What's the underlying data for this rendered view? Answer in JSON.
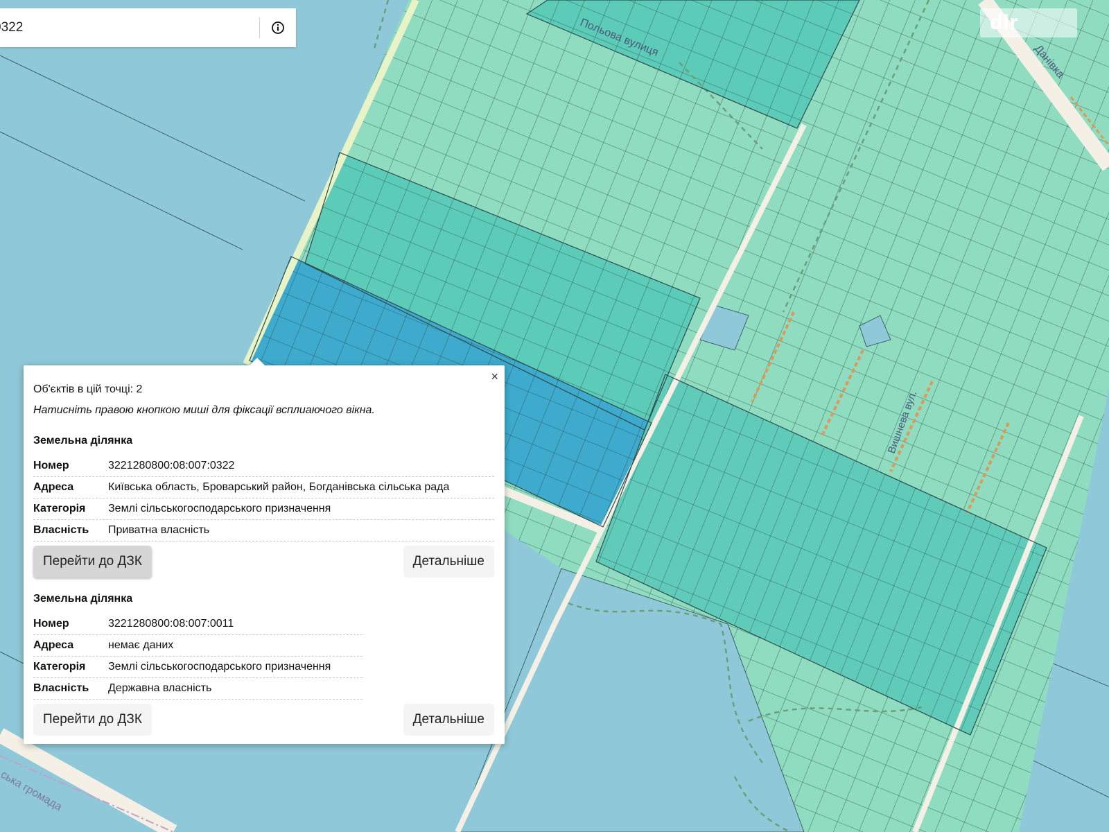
{
  "search": {
    "value": "0322"
  },
  "logo": {
    "text": "dlr"
  },
  "map": {
    "street_labels": [
      "Польова вулиця",
      "Вишнева вул.",
      "Данівка",
      "ська громада"
    ],
    "colors": {
      "water": "#8fc8d8",
      "parcel_light": "#8fdcc0",
      "parcel_mid": "#5ccbb8",
      "parcel_dark": "#3eaacd",
      "road": "#f4f0e6",
      "road_dashed": "#d99a5a",
      "outline": "#2b4b4a"
    }
  },
  "popup": {
    "close_label": "×",
    "count_text": "Об'єктів в цій точці: 2",
    "hint_text": "Натисніть правою кнопкою миші для фіксації всплиаючого вікна.",
    "parcels": [
      {
        "title": "Земельна ділянка",
        "rows": [
          {
            "key": "Номер",
            "value": "3221280800:08:007:0322"
          },
          {
            "key": "Адреса",
            "value": "Київська область, Броварський район, Богданівська сільська рада"
          },
          {
            "key": "Категорія",
            "value": "Землі сільськогосподарського призначення"
          },
          {
            "key": "Власність",
            "value": "Приватна власність"
          }
        ],
        "goto_label": "Перейти до ДЗК",
        "details_label": "Детальніше"
      },
      {
        "title": "Земельна ділянка",
        "rows": [
          {
            "key": "Номер",
            "value": "3221280800:08:007:0011"
          },
          {
            "key": "Адреса",
            "value": "немає даних"
          },
          {
            "key": "Категорія",
            "value": "Землі сільськогосподарського призначення"
          },
          {
            "key": "Власність",
            "value": "Державна власність"
          }
        ],
        "goto_label": "Перейти до ДЗК",
        "details_label": "Детальніше"
      }
    ]
  }
}
